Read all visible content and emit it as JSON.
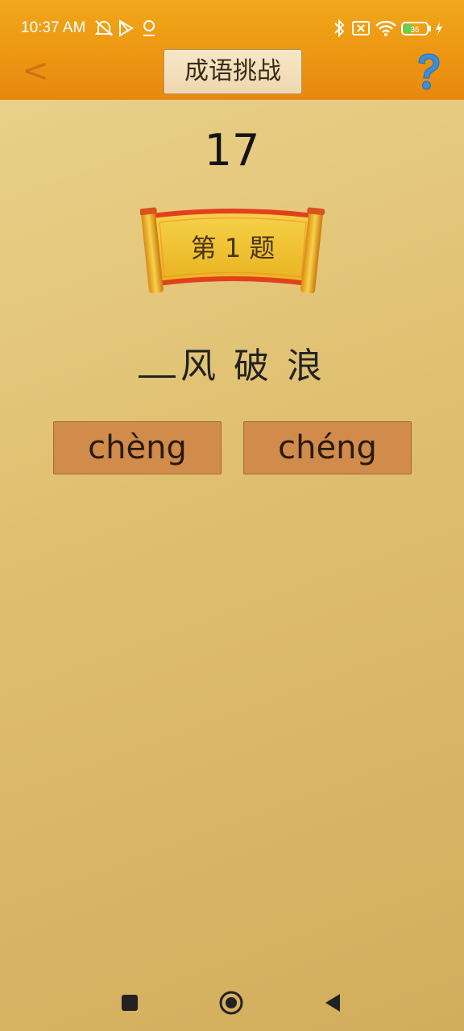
{
  "status_bar": {
    "time": "10:37 AM",
    "battery_level": "36",
    "icons": [
      "alarm-off-icon",
      "play-store-icon",
      "location-icon",
      "bluetooth-icon",
      "sim-x-icon",
      "wifi-icon",
      "battery-icon",
      "charging-icon"
    ]
  },
  "header": {
    "title": "成语挑战",
    "back_label": "<"
  },
  "quiz": {
    "timer": "17",
    "question_label": "第 1 题",
    "idiom_chars": [
      "风",
      "破",
      "浪"
    ],
    "options": [
      "chèng",
      "chéng"
    ]
  },
  "colors": {
    "header": "#ee9b14",
    "background": "#e0c070",
    "option_bg": "#d18b4b",
    "back_arrow": "#d36f10",
    "help_icon": "#3a8fd6"
  }
}
